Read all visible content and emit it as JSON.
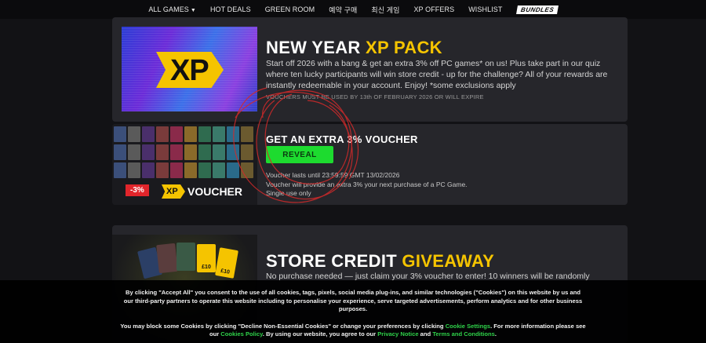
{
  "nav": {
    "items": [
      "ALL GAMES",
      "HOT DEALS",
      "GREEN ROOM",
      "예약 구매",
      "최신 게임",
      "XP OFFERS",
      "WISHLIST"
    ],
    "bundles": "BUNDLES"
  },
  "xp_pack": {
    "title_white": "NEW YEAR",
    "title_yellow": "XP PACK",
    "logo_text": "XP",
    "description": "Start off 2026 with a bang & get an extra 3% off PC games* on us! Plus take part in our quiz where ten lucky participants will win store credit - up for the challenge? All of your rewards are instantly redeemable in your account. Enjoy! *some exclusions apply",
    "fine_print": "VOUCHERS MUST BE USED BY 13th OF FEBRUARY 2026 OR WILL EXPIRE"
  },
  "voucher": {
    "title": "GET AN EXTRA 3% VOUCHER",
    "button": "REVEAL",
    "badge": "-3%",
    "xp_label": "XP",
    "voucher_word": "VOUCHER",
    "lines": [
      "Voucher lasts until 23:59:59 GMT 13/02/2026",
      "Voucher will provide an extra 3% your next purchase of a PC Game.",
      "Single use only"
    ],
    "colors": {
      "button": "#1ddb2f",
      "badge": "#e1252b",
      "accent": "#f5c400"
    }
  },
  "giveaway": {
    "title_white": "STORE CREDIT",
    "title_yellow": "GIVEAWAY",
    "description": "No purchase needed — just claim your 3% voucher to enter! 10 winners will be randomly",
    "card_labels": [
      "£10",
      "£10"
    ]
  },
  "cookie": {
    "p1": "By clicking \"Accept All\" you consent to the use of all cookies, tags, pixels, social media plug-ins, and similar technologies (\"Cookies\") on this website by us and our third-party partners to operate this website including to personalise your experience, serve targeted advertisements, perform analytics and for other business purposes.",
    "p2_a": "You may block some Cookies by clicking \"Decline Non-Essential Cookies\" or change your preferences by clicking",
    "link_settings": "Cookie Settings",
    "p2_b": ". For more information please see our",
    "link_policy": "Cookies Policy",
    "p2_c": ". By using our website, you agree to our",
    "link_privacy": "Privacy Notice",
    "p2_d": "and",
    "link_terms": "Terms and Conditions",
    "p2_e": "."
  }
}
